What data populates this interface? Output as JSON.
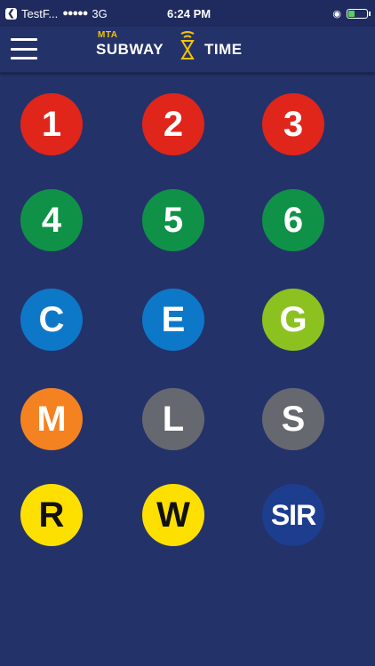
{
  "status_bar": {
    "back_app": "TestF...",
    "signal": "●●●●●",
    "carrier": "3G",
    "time": "6:24 PM",
    "alarm_icon": "alarm-icon",
    "battery_icon": "battery-icon",
    "battery_level": 0.35
  },
  "header": {
    "menu_icon": "hamburger-menu-icon",
    "logo_top": "MTA",
    "logo_left": "SUBWAY",
    "logo_right": "TIME"
  },
  "colors": {
    "background": "#24326a",
    "red": "#e0251b",
    "green": "#0f9247",
    "blue": "#0e78c8",
    "lime": "#8cc21f",
    "orange": "#f58220",
    "gray": "#666870",
    "yellow": "#fde000",
    "sir_blue": "#1d3d8f"
  },
  "lines": [
    {
      "label": "1",
      "color": "#e0251b",
      "text_color": "#ffffff"
    },
    {
      "label": "2",
      "color": "#e0251b",
      "text_color": "#ffffff"
    },
    {
      "label": "3",
      "color": "#e0251b",
      "text_color": "#ffffff"
    },
    {
      "label": "4",
      "color": "#0f9247",
      "text_color": "#ffffff"
    },
    {
      "label": "5",
      "color": "#0f9247",
      "text_color": "#ffffff"
    },
    {
      "label": "6",
      "color": "#0f9247",
      "text_color": "#ffffff"
    },
    {
      "label": "C",
      "color": "#0e78c8",
      "text_color": "#ffffff"
    },
    {
      "label": "E",
      "color": "#0e78c8",
      "text_color": "#ffffff"
    },
    {
      "label": "G",
      "color": "#8cc21f",
      "text_color": "#ffffff"
    },
    {
      "label": "M",
      "color": "#f58220",
      "text_color": "#ffffff"
    },
    {
      "label": "L",
      "color": "#666870",
      "text_color": "#ffffff"
    },
    {
      "label": "S",
      "color": "#666870",
      "text_color": "#ffffff"
    },
    {
      "label": "R",
      "color": "#fde000",
      "text_color": "#111111"
    },
    {
      "label": "W",
      "color": "#fde000",
      "text_color": "#111111"
    },
    {
      "label": "SIR",
      "color": "#1d3d8f",
      "text_color": "#ffffff"
    }
  ]
}
